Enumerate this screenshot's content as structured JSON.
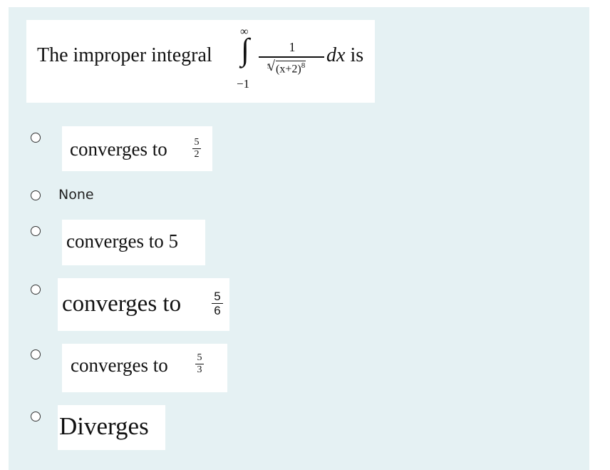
{
  "question": {
    "prefix": "The improper integral",
    "integral_symbol": "∫",
    "upper_limit": "∞",
    "lower_limit": "−1",
    "numerator": "1",
    "root_index": "5",
    "radicand": "(x+2)",
    "exponent": "8",
    "dx": "dx",
    "suffix": "is"
  },
  "options": [
    {
      "text": "converges to",
      "frac_num": "5",
      "frac_den": "2",
      "selected": false
    },
    {
      "text": "None",
      "selected": false
    },
    {
      "text": "converges to 5",
      "selected": false
    },
    {
      "text": "converges to",
      "frac_num": "5",
      "frac_den": "6",
      "selected": false
    },
    {
      "text": "converges to",
      "frac_num": "5",
      "frac_den": "3",
      "selected": false
    },
    {
      "text": "Diverges",
      "selected": false
    }
  ],
  "colors": {
    "panel_background": "#e5f1f3",
    "card_background": "#ffffff",
    "text": "#111111"
  }
}
